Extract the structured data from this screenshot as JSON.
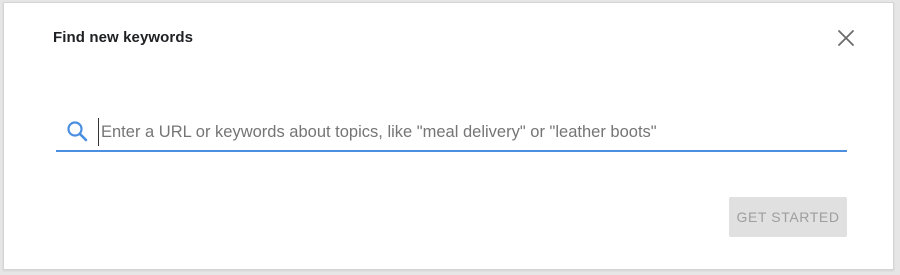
{
  "dialog": {
    "title": "Find new keywords",
    "close_icon": "close-icon"
  },
  "search": {
    "icon": "search-icon",
    "value": "",
    "placeholder": "Enter a URL or keywords about topics, like \"meal delivery\" or \"leather boots\""
  },
  "actions": {
    "get_started_label": "GET STARTED",
    "get_started_enabled": false
  },
  "colors": {
    "accent": "#4a8fe0",
    "button_disabled_bg": "#e0e0e0",
    "button_disabled_text": "#9e9e9e"
  }
}
